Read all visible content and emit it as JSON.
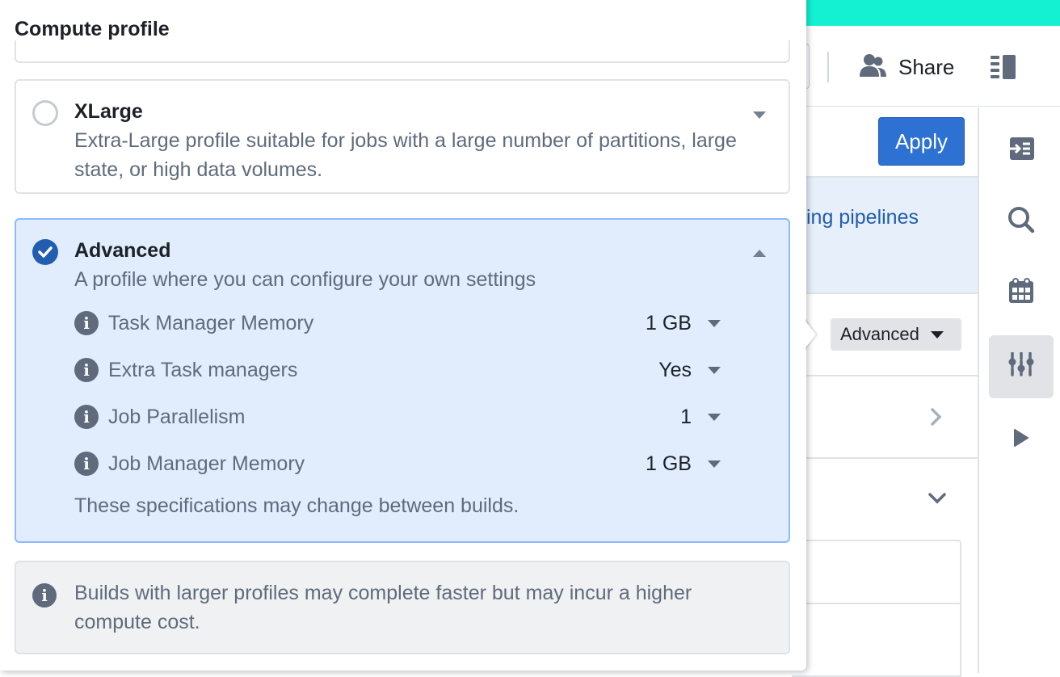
{
  "header": {
    "share_label": "Share",
    "share_icon": "people-icon",
    "panel_toggle_icon": "panel-layout-icon"
  },
  "toolbar": {
    "apply_label": "Apply"
  },
  "background": {
    "banner_link_text": "ing pipelines",
    "profile_select_value": "Advanced"
  },
  "rail": {
    "items": [
      {
        "icon": "import-icon",
        "active": false
      },
      {
        "icon": "search-icon",
        "active": false
      },
      {
        "icon": "calendar-icon",
        "active": false
      },
      {
        "icon": "sliders-icon",
        "active": true
      },
      {
        "icon": "play-icon",
        "active": false
      }
    ]
  },
  "popover": {
    "title": "Compute profile",
    "profiles": [
      {
        "name": "XLarge",
        "description": "Extra-Large profile suitable for jobs with a large number of partitions, large state, or high data volumes.",
        "selected": false,
        "expanded": false
      },
      {
        "name": "Advanced",
        "description": "A profile where you can configure your own settings",
        "selected": true,
        "expanded": true,
        "settings": [
          {
            "label": "Task Manager Memory",
            "value": "1 GB"
          },
          {
            "label": "Extra Task managers",
            "value": "Yes"
          },
          {
            "label": "Job Parallelism",
            "value": "1"
          },
          {
            "label": "Job Manager Memory",
            "value": "1 GB"
          }
        ],
        "note": "These specifications may change between builds."
      }
    ],
    "callout_text": "Builds with larger profiles may complete faster but may incur a higher compute cost."
  },
  "colors": {
    "accent_bar": "#14f1d2",
    "primary": "#2d72d2",
    "selected_bg": "#e1ecfd",
    "selected_border": "#8abbff"
  }
}
